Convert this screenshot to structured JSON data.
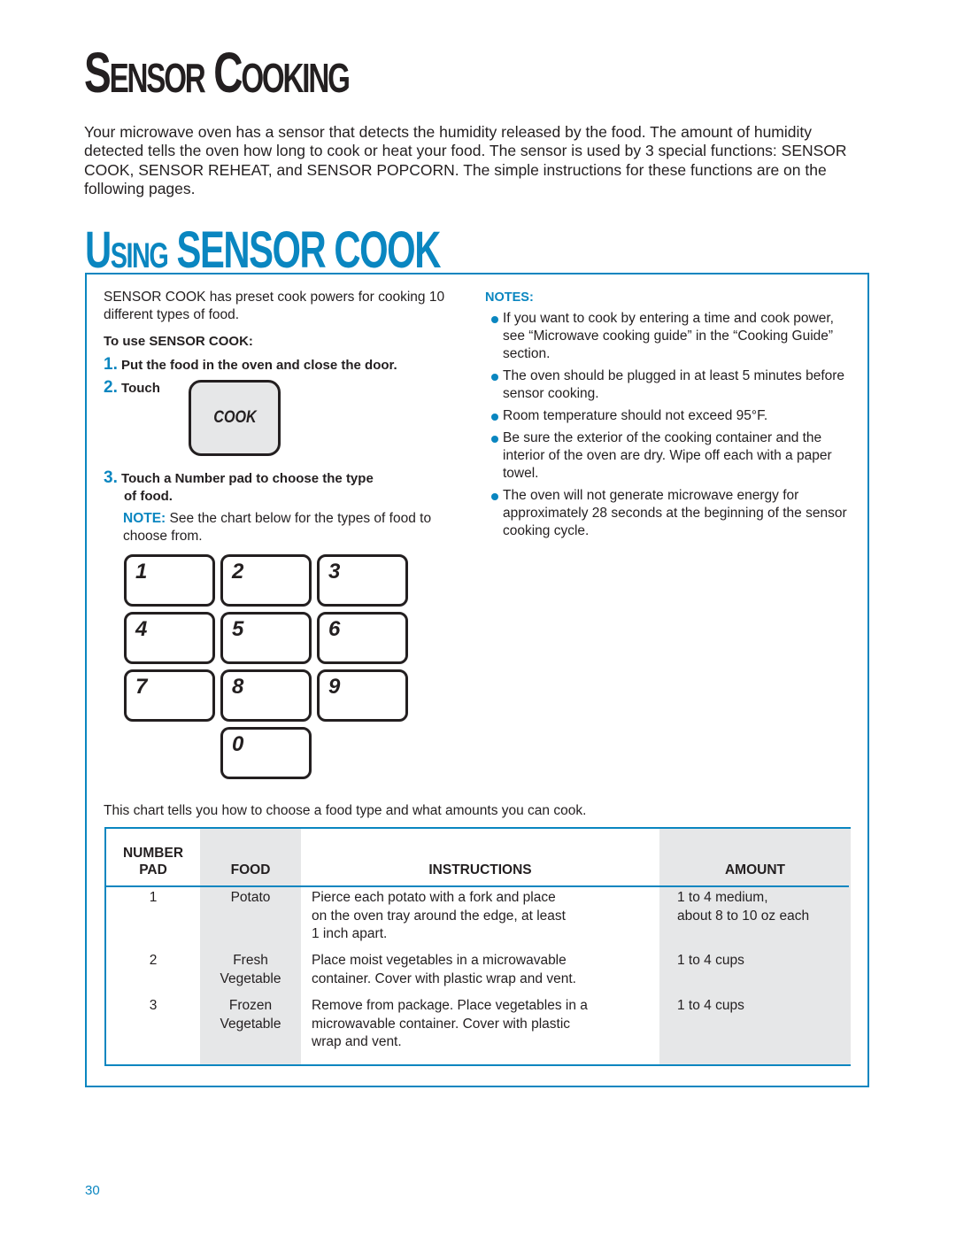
{
  "page": {
    "title": {
      "first_cap": "S",
      "first_rest": "ENSOR",
      "second_cap": "C",
      "second_rest": "OOKING"
    },
    "intro": "Your microwave oven has a sensor that detects the humidity released by the food. The amount of humidity detected tells the oven how long to cook or heat your food. The sensor is used by 3 special functions: SENSOR COOK, SENSOR REHEAT, and SENSOR POPCORN. The simple instructions for these functions are on the following pages.",
    "subtitle": {
      "cap": "U",
      "rest": "SING",
      "main": "SENSOR COOK"
    },
    "page_number": "30"
  },
  "left": {
    "description": "SENSOR COOK has preset cook powers for cooking 10 different types of food.",
    "to_use_heading": "To use SENSOR COOK:",
    "steps": [
      {
        "num": "1.",
        "text": "Put the food in the oven and close the door."
      },
      {
        "num": "2.",
        "text": "Touch"
      },
      {
        "num": "3.",
        "text_line1": "Touch a Number pad to choose the type",
        "text_line2": "of food."
      }
    ],
    "cook_key_label": "COOK",
    "note_label": "NOTE:",
    "note_text": " See the chart below for the types of food to choose from.",
    "keypad": [
      "1",
      "2",
      "3",
      "4",
      "5",
      "6",
      "7",
      "8",
      "9",
      "0"
    ]
  },
  "notes": {
    "heading": "NOTES:",
    "items": [
      "If you want to cook by entering a time and cook power, see “Microwave cooking guide” in the “Cooking Guide” section.",
      "The oven should be plugged in at least 5 minutes before sensor cooking.",
      "Room temperature should not exceed 95°F.",
      "Be sure the exterior of the cooking container and the interior of the oven are dry. Wipe off each with a paper towel.",
      "The oven will not generate microwave energy for approximately 28 seconds at the beginning of the sensor cooking cycle."
    ]
  },
  "chart": {
    "intro": "This chart tells you how to choose a food type and what amounts you can cook.",
    "headers": {
      "number_line1": "NUMBER",
      "number_line2": "PAD",
      "food": "FOOD",
      "instructions": "INSTRUCTIONS",
      "amount": "AMOUNT"
    },
    "rows": [
      {
        "number": "1",
        "food": [
          "Potato"
        ],
        "instructions": [
          "Pierce each potato with a fork and place",
          "on the oven tray around the edge, at least",
          "1 inch apart."
        ],
        "amount": [
          "1 to 4 medium,",
          "about 8 to 10 oz each"
        ]
      },
      {
        "number": "2",
        "food": [
          "Fresh",
          "Vegetable"
        ],
        "instructions": [
          "Place moist vegetables in a microwavable",
          "container. Cover with plastic wrap and vent."
        ],
        "amount": [
          "1 to 4 cups"
        ]
      },
      {
        "number": "3",
        "food": [
          "Frozen",
          "Vegetable"
        ],
        "instructions": [
          "Remove from package. Place vegetables in a",
          "microwavable container. Cover with plastic",
          "wrap and vent."
        ],
        "amount": [
          "1 to 4 cups"
        ]
      }
    ]
  },
  "colors": {
    "accent": "#0a86c0",
    "text": "#231f20",
    "shade": "#e6e7e8"
  }
}
